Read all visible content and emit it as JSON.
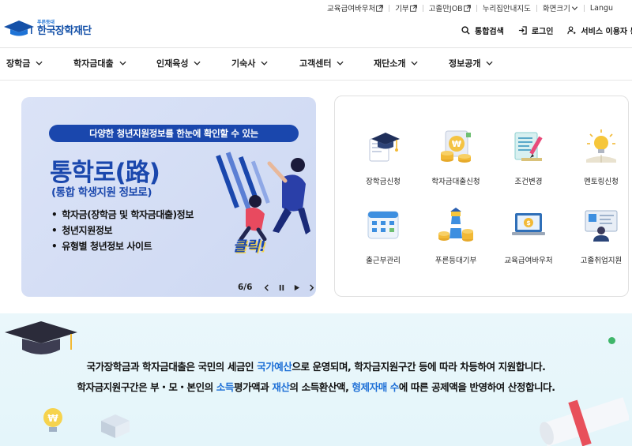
{
  "util_links": [
    {
      "label": "교육급여바우처",
      "external": true
    },
    {
      "label": "기부",
      "external": true
    },
    {
      "label": "고졸만JOB",
      "external": true
    },
    {
      "label": "누리집안내지도",
      "external": false
    },
    {
      "label": "화면크기",
      "external": false
    },
    {
      "label": "Langu",
      "external": false
    }
  ],
  "logo": {
    "small": "푸른등대",
    "main": "한국장학재단"
  },
  "header_actions": [
    {
      "label": "통합검색",
      "icon": "search-icon"
    },
    {
      "label": "로그인",
      "icon": "login-icon"
    },
    {
      "label": "서비스 이용자 등",
      "icon": "user-icon"
    }
  ],
  "gnb": [
    "장학금",
    "학자금대출",
    "인재육성",
    "기숙사",
    "고객센터",
    "재단소개",
    "정보공개"
  ],
  "banner": {
    "pill": "다양한 청년지원정보를 한눈에 확인할 수 있는",
    "title": "통학로(路)",
    "subtitle": "(통합 학생지원 정보로)",
    "bullets": [
      "학자금(장학금 및 학자금대출)정보",
      "청년지원정보",
      "유형별 청년정보 사이트"
    ],
    "badge": "클릭!",
    "counter": "6/6"
  },
  "quick_menu": [
    {
      "label": "장학금신청",
      "icon": "graduation-cap-icon"
    },
    {
      "label": "학자금대출신청",
      "icon": "coin-stack-icon"
    },
    {
      "label": "조건변경",
      "icon": "document-pen-icon"
    },
    {
      "label": "멘토링신청",
      "icon": "lightbulb-icon"
    },
    {
      "label": "출근부관리",
      "icon": "calendar-icon"
    },
    {
      "label": "푸른등대기부",
      "icon": "lighthouse-icon"
    },
    {
      "label": "교육급여바우처",
      "icon": "laptop-dollar-icon"
    },
    {
      "label": "고졸취업지원",
      "icon": "board-presenter-icon"
    }
  ],
  "notice": {
    "line1": [
      {
        "t": "국가장학금과 학자금대출은 국민의 세금인 ",
        "hl": false
      },
      {
        "t": "국가예산",
        "hl": true
      },
      {
        "t": "으로 운영되며, 학자금지원구간 등에 따라 차등하여 지원합니다.",
        "hl": false
      }
    ],
    "line2": [
      {
        "t": "학자금지원구간은 부・모・본인의 ",
        "hl": false
      },
      {
        "t": "소득",
        "hl": true
      },
      {
        "t": "평가액과 ",
        "hl": false
      },
      {
        "t": "재산",
        "hl": true
      },
      {
        "t": "의 소득환산액, ",
        "hl": false
      },
      {
        "t": "형제자매 수",
        "hl": true
      },
      {
        "t": "에 따른 공제액을 반영하여 산정합니다.",
        "hl": false
      }
    ]
  },
  "colors": {
    "brand_blue": "#1a47ad",
    "highlight": "#1d6fd6",
    "notice_bg": "#e4f5fa"
  }
}
